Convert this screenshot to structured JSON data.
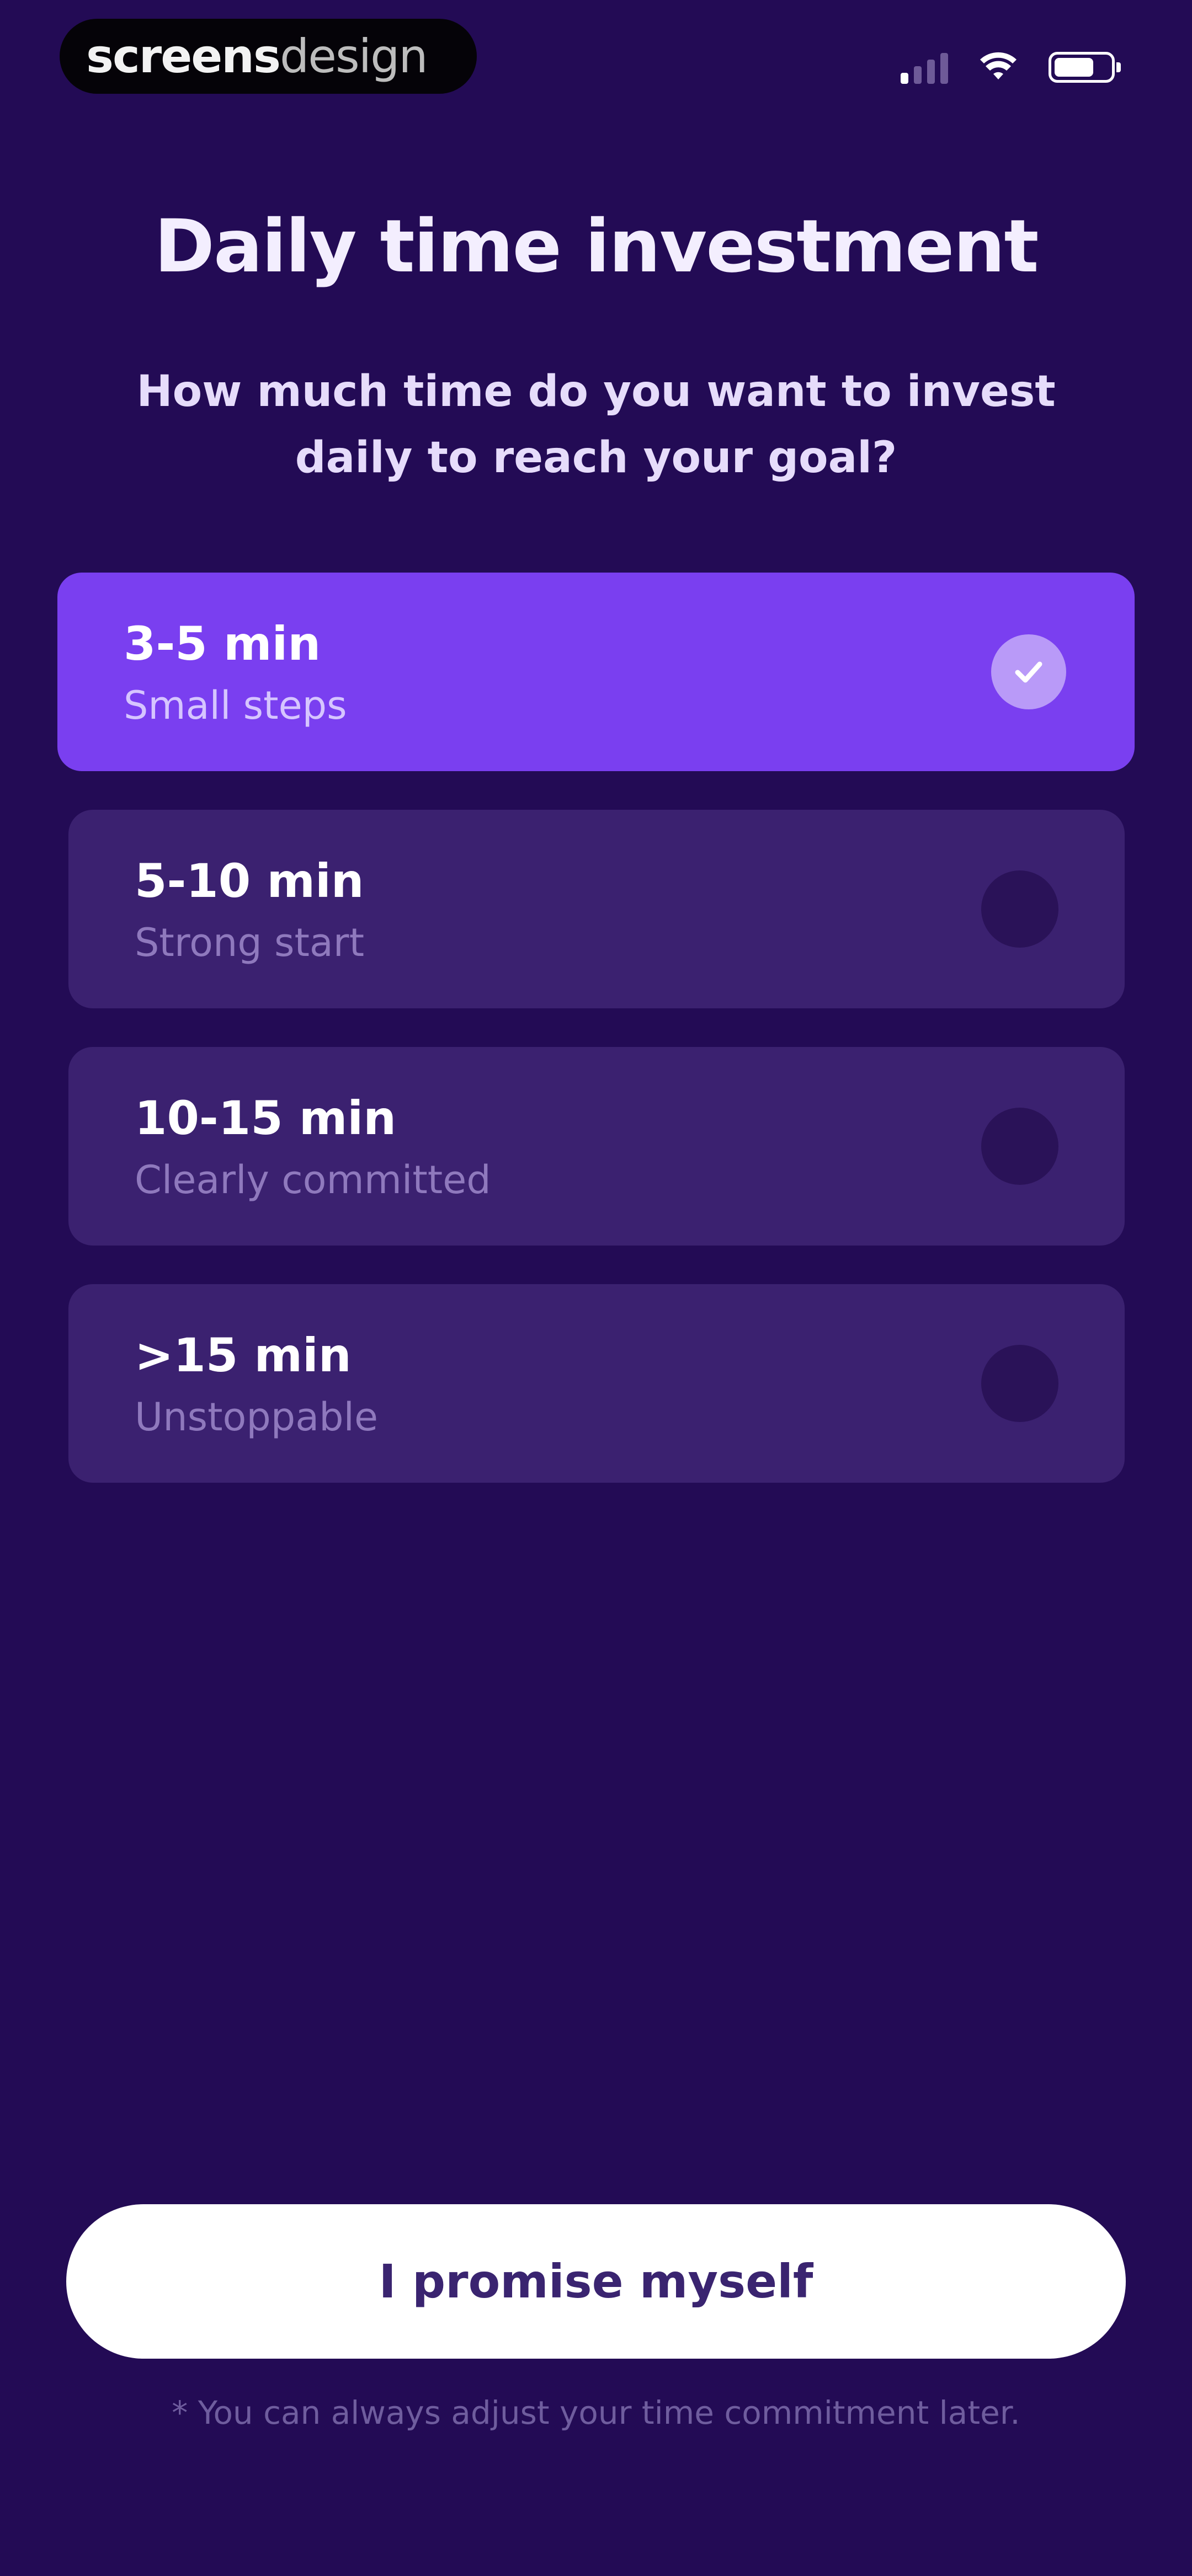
{
  "status_bar": {
    "brand_bold": "screens",
    "brand_light": "design",
    "signal_icon": "cellular-signal-icon",
    "wifi_icon": "wifi-icon",
    "battery_icon": "battery-icon"
  },
  "header": {
    "title": "Daily time investment",
    "subtitle": "How much time do you want to invest daily to reach your goal?"
  },
  "options": [
    {
      "label": "3-5 min",
      "sublabel": "Small steps",
      "selected": true
    },
    {
      "label": "5-10 min",
      "sublabel": "Strong start",
      "selected": false
    },
    {
      "label": "10-15 min",
      "sublabel": "Clearly committed",
      "selected": false
    },
    {
      "label": ">15 min",
      "sublabel": "Unstoppable",
      "selected": false
    }
  ],
  "footer": {
    "button_label": "I promise myself",
    "note": "* You can always adjust your time commitment later."
  },
  "colors": {
    "background": "#230b55",
    "selected_option": "#7a3ff0",
    "unselected_option": "#3b2170",
    "button": "#ffffff",
    "button_text": "#3a2470"
  }
}
